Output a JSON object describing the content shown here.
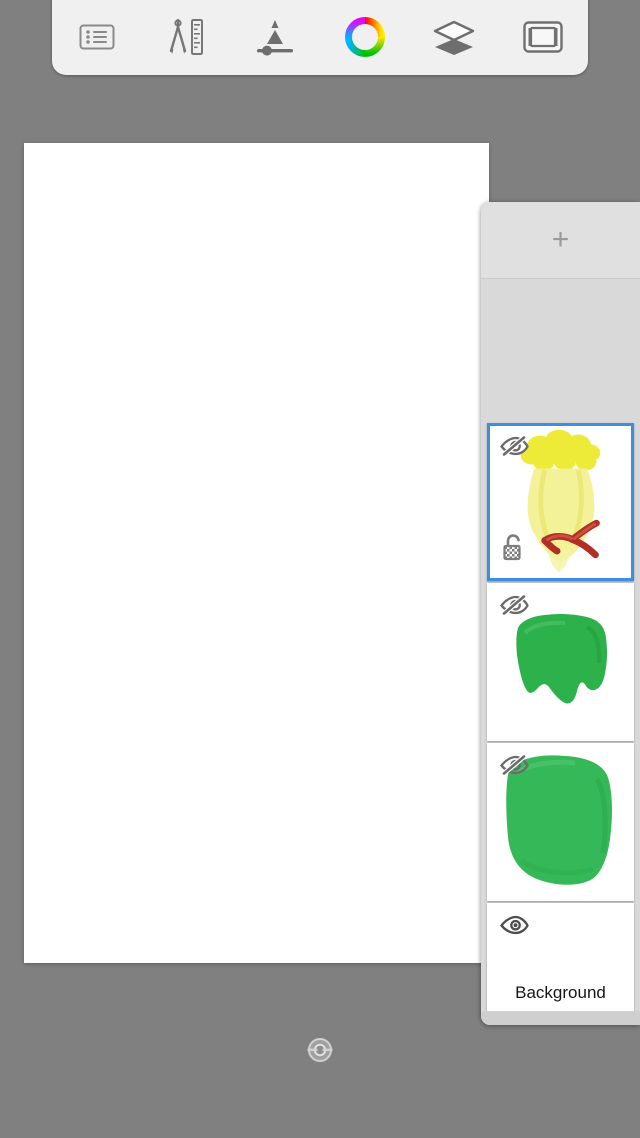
{
  "app": {
    "background_color": "#808080",
    "accent_color": "#3d8ee0"
  },
  "toolbar": {
    "name": "top-toolbar",
    "items": [
      {
        "id": "menu",
        "label": "Menu",
        "icon": "list-menu-icon"
      },
      {
        "id": "tools",
        "label": "Tools",
        "icon": "compass-ruler-icon"
      },
      {
        "id": "brush",
        "label": "Brush",
        "icon": "brush-size-slider-icon"
      },
      {
        "id": "color",
        "label": "Color",
        "icon": "color-wheel-icon"
      },
      {
        "id": "layers",
        "label": "Layers",
        "icon": "layers-stack-icon"
      },
      {
        "id": "fullscreen",
        "label": "Full Screen",
        "icon": "canvas-frame-icon"
      }
    ]
  },
  "canvas": {
    "name": "drawing-canvas",
    "fill": "#ffffff"
  },
  "layers_panel": {
    "add_button": {
      "label": "+",
      "icon": "plus-icon"
    },
    "layers": [
      {
        "name": "",
        "visible": false,
        "selected": true,
        "locked": false,
        "alpha_lock_icon": "unlocked-padlock-icon",
        "visibility_icon": "eye-hidden-icon",
        "thumbnail": "yellow-flower-bouquet-with-red-ribbon"
      },
      {
        "name": "",
        "visible": false,
        "selected": false,
        "visibility_icon": "eye-hidden-icon",
        "thumbnail": "green-brush-stroke"
      },
      {
        "name": "",
        "visible": false,
        "selected": false,
        "visibility_icon": "eye-hidden-icon",
        "thumbnail": "green-solid-block"
      },
      {
        "name": "Background",
        "visible": true,
        "selected": false,
        "visibility_icon": "eye-visible-icon",
        "thumbnail": "white-background"
      }
    ]
  },
  "footer": {
    "reset_rotation": {
      "label": "Reset Canvas Rotation",
      "icon": "reset-rotation-icon"
    }
  }
}
